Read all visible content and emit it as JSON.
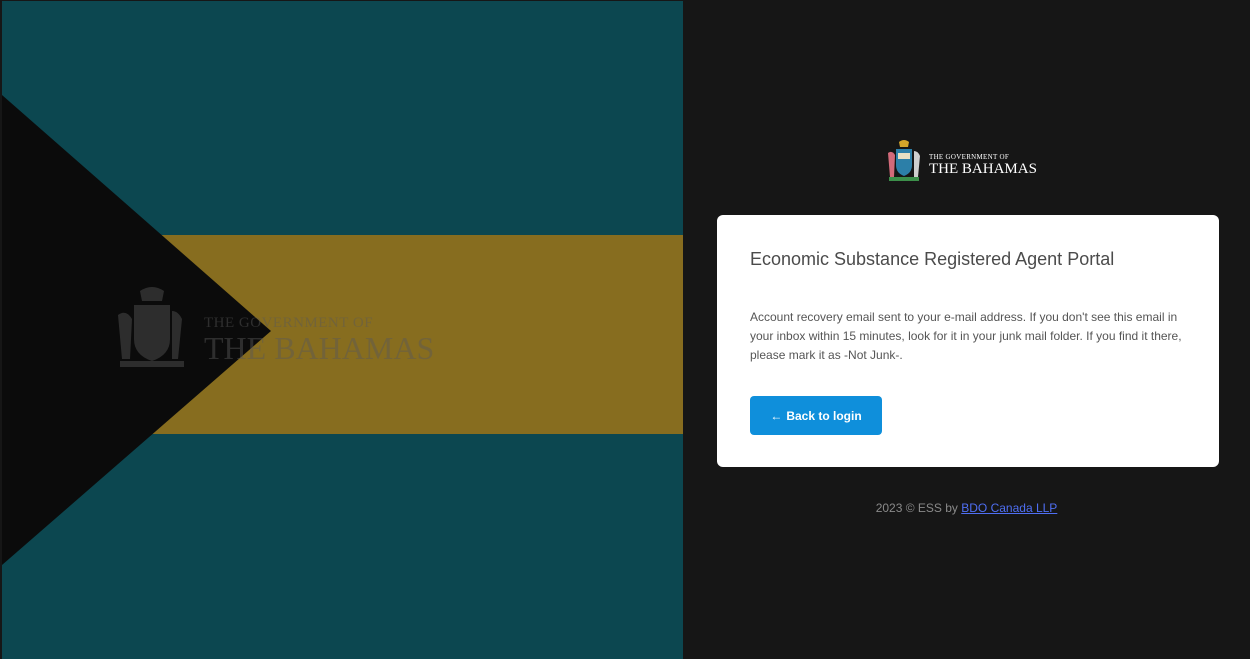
{
  "branding": {
    "small_line": "THE GOVERNMENT OF",
    "large_line": "THE BAHAMAS"
  },
  "card": {
    "title": "Economic Substance Registered Agent Portal",
    "message": "Account recovery email sent to your e-mail address. If you don't see this email in your inbox within 15 minutes, look for it in your junk mail folder. If you find it there, please mark it as -Not Junk-.",
    "back_button": {
      "arrow": "←",
      "label": "Back to login"
    }
  },
  "footer": {
    "text": "2023 © ESS by ",
    "link_label": "BDO Canada LLP"
  },
  "colors": {
    "aquamarine": "#0c4750",
    "gold": "#876d1f",
    "black": "#0b0b0b",
    "panel_dark": "#161616",
    "button_blue": "#0f8fdb",
    "link_blue": "#4f6ff4"
  }
}
